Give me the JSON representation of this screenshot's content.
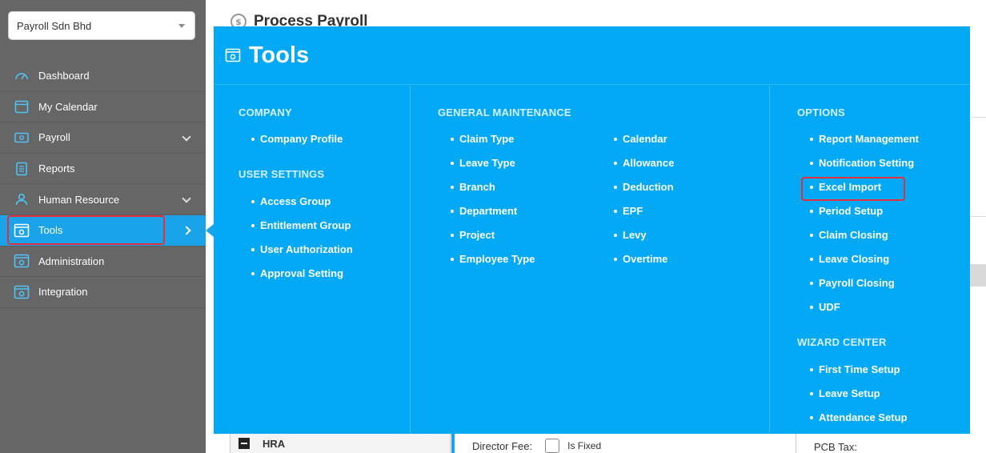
{
  "sidebar": {
    "company": "Payroll Sdn Bhd",
    "items": [
      {
        "label": "Dashboard",
        "icon": "dashboard-icon",
        "expandable": false
      },
      {
        "label": "My Calendar",
        "icon": "calendar-icon",
        "expandable": false
      },
      {
        "label": "Payroll",
        "icon": "payroll-icon",
        "expandable": true
      },
      {
        "label": "Reports",
        "icon": "reports-icon",
        "expandable": false
      },
      {
        "label": "Human Resource",
        "icon": "human-resource-icon",
        "expandable": true
      },
      {
        "label": "Tools",
        "icon": "tools-icon",
        "expandable": true,
        "active": true
      },
      {
        "label": "Administration",
        "icon": "administration-icon",
        "expandable": false
      },
      {
        "label": "Integration",
        "icon": "integration-icon",
        "expandable": false
      }
    ]
  },
  "page": {
    "title": "Process Payroll",
    "hra_label": "HRA",
    "director_fee_label": "Director Fee:",
    "is_fixed_label": "Is Fixed",
    "pcb_tax_label": "PCB Tax:"
  },
  "tools": {
    "title": "Tools",
    "company_title": "COMPANY",
    "company_items": [
      "Company Profile"
    ],
    "user_settings_title": "USER SETTINGS",
    "user_settings_items": [
      "Access Group",
      "Entitlement Group",
      "User Authorization",
      "Approval Setting"
    ],
    "general_title": "GENERAL MAINTENANCE",
    "general_col1": [
      "Claim Type",
      "Leave Type",
      "Branch",
      "Department",
      "Project",
      "Employee Type"
    ],
    "general_col2": [
      "Calendar",
      "Allowance",
      "Deduction",
      "EPF",
      "Levy",
      "Overtime"
    ],
    "options_title": "OPTIONS",
    "options_items": [
      "Report Management",
      "Notification Setting",
      "Excel Import",
      "Period Setup",
      "Claim Closing",
      "Leave Closing",
      "Payroll Closing",
      "UDF"
    ],
    "wizard_title": "WIZARD CENTER",
    "wizard_items": [
      "First Time Setup",
      "Leave Setup",
      "Attendance Setup"
    ]
  },
  "colors": {
    "sidebar_bg": "#666666",
    "accent": "#03a9f4",
    "highlight": "#e0313b"
  }
}
